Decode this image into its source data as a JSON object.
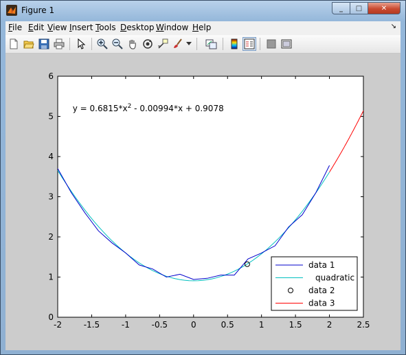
{
  "window": {
    "title": "Figure 1",
    "controls": {
      "minimize": "_",
      "maximize": "□",
      "close": "✕"
    }
  },
  "menubar": {
    "items": [
      "File",
      "Edit",
      "View",
      "Insert",
      "Tools",
      "Desktop",
      "Window",
      "Help"
    ],
    "dock_glyph": "↘"
  },
  "toolbar": {
    "buttons": [
      {
        "icon": "new-figure-icon"
      },
      {
        "icon": "open-file-icon"
      },
      {
        "icon": "save-icon"
      },
      {
        "icon": "print-icon"
      },
      {
        "icon": "edit-plot-arrow-icon"
      },
      {
        "icon": "zoom-in-icon"
      },
      {
        "icon": "zoom-out-icon"
      },
      {
        "icon": "pan-hand-icon"
      },
      {
        "icon": "rotate-3d-icon"
      },
      {
        "icon": "data-cursor-icon"
      },
      {
        "icon": "brush-icon"
      },
      {
        "icon": "link-plot-icon"
      },
      {
        "icon": "colorbar-icon"
      },
      {
        "icon": "legend-icon"
      },
      {
        "icon": "hide-plot-tools-icon"
      },
      {
        "icon": "show-plot-tools-icon"
      }
    ]
  },
  "chart_data": {
    "type": "line",
    "annotation": "y = 0.6815*x^2 - 0.00994*x + 0.9078",
    "xlim": [
      -2,
      2.5
    ],
    "ylim": [
      0,
      6
    ],
    "xticks": [
      "-2",
      "-1.5",
      "-1",
      "-0.5",
      "0",
      "0.5",
      "1",
      "1.5",
      "2",
      "2.5"
    ],
    "yticks": [
      "0",
      "1",
      "2",
      "3",
      "4",
      "5",
      "6"
    ],
    "legend_position": "bottom-right",
    "series": [
      {
        "name": "data 1",
        "kind": "line",
        "color": "#0000cc",
        "x": [
          -2,
          -1.8,
          -1.6,
          -1.4,
          -1.2,
          -1.0,
          -0.8,
          -0.6,
          -0.4,
          -0.2,
          0.0,
          0.2,
          0.4,
          0.6,
          0.8,
          1.0,
          1.2,
          1.4,
          1.6,
          1.8,
          2.0
        ],
        "y": [
          3.7,
          3.1,
          2.6,
          2.15,
          1.85,
          1.6,
          1.3,
          1.2,
          1.0,
          1.07,
          0.94,
          0.97,
          1.05,
          1.05,
          1.45,
          1.6,
          1.78,
          2.25,
          2.55,
          3.1,
          3.78
        ]
      },
      {
        "name": "quadratic",
        "kind": "line",
        "color": "#00bfbf",
        "coefficients": [
          0.6815,
          -0.00994,
          0.9078
        ],
        "x_range": [
          -2,
          2
        ]
      },
      {
        "name": "data 2",
        "kind": "marker",
        "marker": "circle",
        "color": "#000000",
        "x": [
          0.79
        ],
        "y": [
          1.32
        ]
      },
      {
        "name": "data 3",
        "kind": "line",
        "color": "#ff0000",
        "coefficients": [
          0.6815,
          -0.00994,
          0.9078
        ],
        "x_range": [
          2,
          2.5
        ]
      }
    ]
  }
}
